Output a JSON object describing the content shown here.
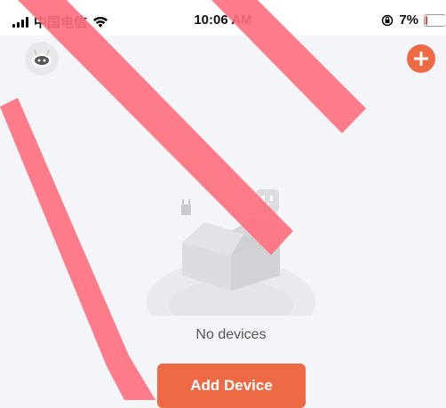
{
  "status_bar": {
    "carrier": "中国电信",
    "time": "10:06 AM",
    "battery_percent": "7%",
    "battery_level": 0.07,
    "signal_icon": "signal-bars-icon",
    "wifi_icon": "wifi-icon",
    "orientation_lock_icon": "orientation-lock-icon"
  },
  "header": {
    "logo_icon": "robot-logo-icon",
    "add_icon": "plus-icon"
  },
  "empty_state": {
    "message": "No devices",
    "illustration_icon": "empty-box-icon"
  },
  "actions": {
    "add_device_label": "Add Device"
  },
  "colors": {
    "accent": "#ee6a45",
    "background": "#f4f5f9",
    "watermark": "#ff6f7d"
  }
}
